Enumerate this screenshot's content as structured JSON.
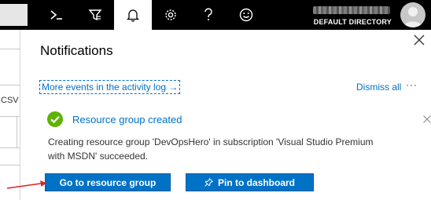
{
  "topbar": {
    "icons": [
      "cloud-shell-icon",
      "directory-filter-icon",
      "bell-icon",
      "gear-icon",
      "help-icon",
      "smiley-icon"
    ],
    "account": {
      "directory": "DEFAULT DIRECTORY"
    }
  },
  "background": {
    "csv_label": "CSV"
  },
  "panel": {
    "title": "Notifications",
    "activity_link": "More events in the activity log",
    "activity_arrow": "→",
    "dismiss_all": "Dismiss all",
    "more": "···"
  },
  "notification": {
    "status": "success",
    "title": "Resource group created",
    "body": "Creating resource group 'DevOpsHero' in subscription 'Visual Studio Premium with MSDN' succeeded.",
    "primary_button": "Go to resource group",
    "secondary_button": "Pin to dashboard"
  },
  "colors": {
    "accent": "#0072c6",
    "success": "#5db300",
    "annotation_arrow": "#e02020",
    "topbar": "#000000"
  }
}
